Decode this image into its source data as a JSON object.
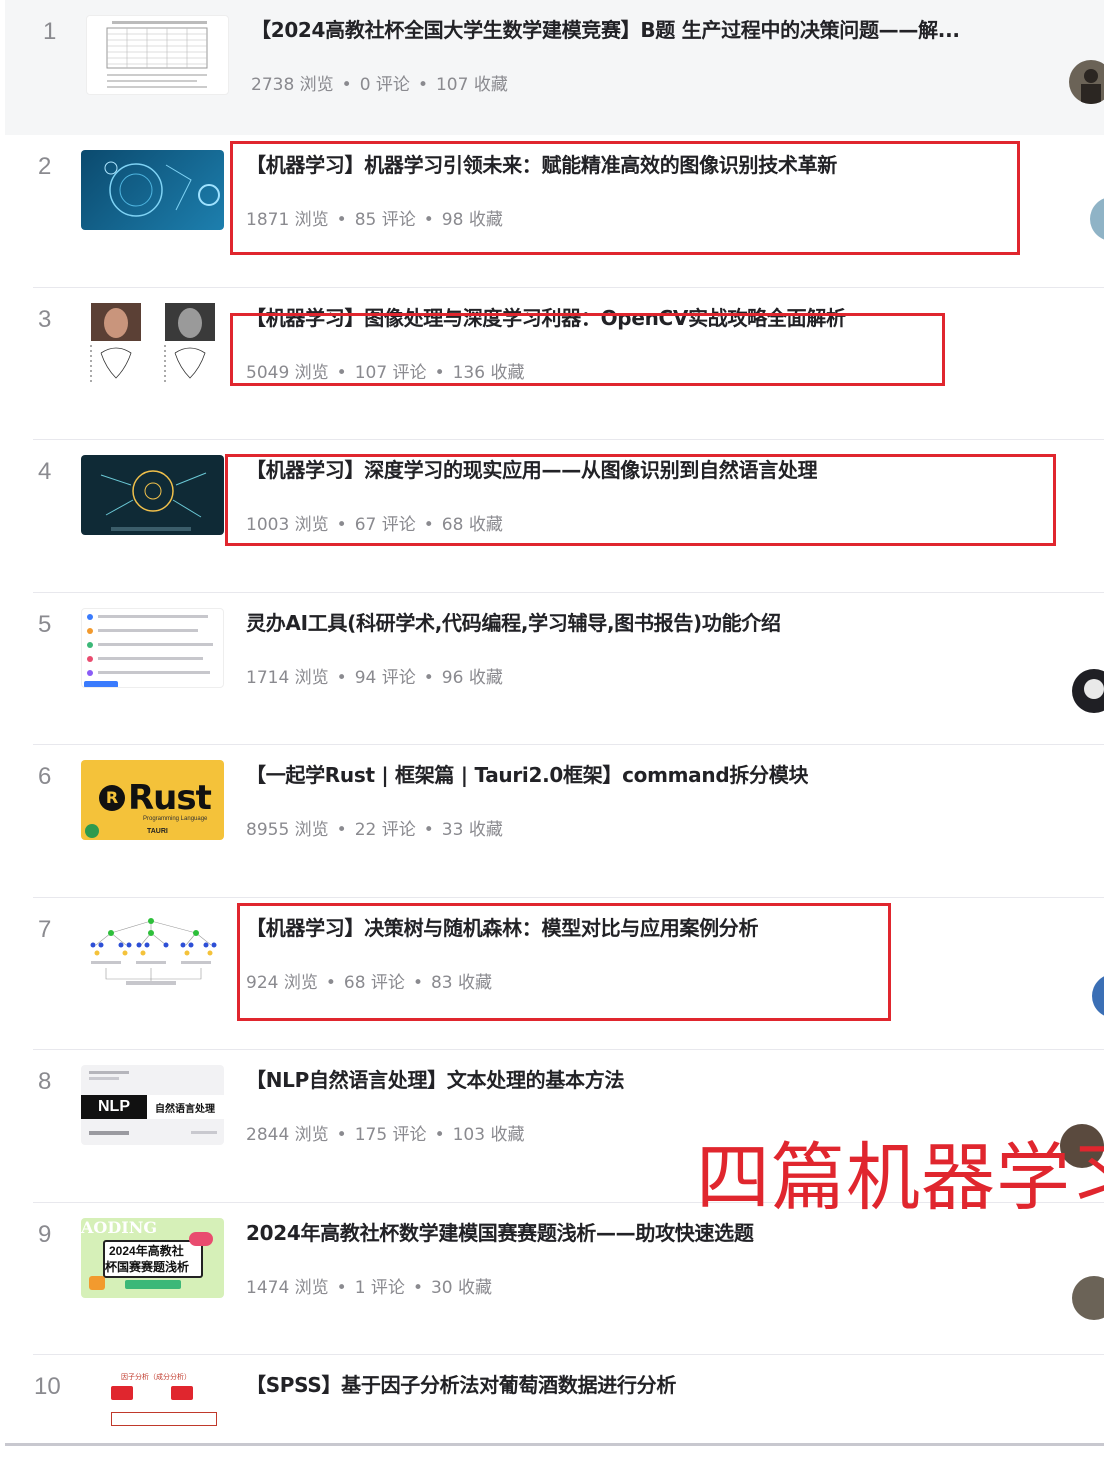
{
  "articles": [
    {
      "rank": "1",
      "title": "【2024高教社杯全国大学生数学建模竞赛】B题 生产过程中的决策问题——解...",
      "views": "2738 浏览",
      "comments": "0 评论",
      "favorites": "107 收藏"
    },
    {
      "rank": "2",
      "title": "【机器学习】机器学习引领未来：赋能精准高效的图像识别技术革新",
      "views": "1871 浏览",
      "comments": "85 评论",
      "favorites": "98 收藏"
    },
    {
      "rank": "3",
      "title": "【机器学习】图像处理与深度学习利器：OpenCV实战攻略全面解析",
      "views": "5049 浏览",
      "comments": "107 评论",
      "favorites": "136 收藏"
    },
    {
      "rank": "4",
      "title": "【机器学习】深度学习的现实应用——从图像识别到自然语言处理",
      "views": "1003 浏览",
      "comments": "67 评论",
      "favorites": "68 收藏"
    },
    {
      "rank": "5",
      "title": "灵办AI工具(科研学术,代码编程,学习辅导,图书报告)功能介绍",
      "views": "1714 浏览",
      "comments": "94 评论",
      "favorites": "96 收藏"
    },
    {
      "rank": "6",
      "title": "【一起学Rust | 框架篇 | Tauri2.0框架】command拆分模块",
      "views": "8955 浏览",
      "comments": "22 评论",
      "favorites": "33 收藏"
    },
    {
      "rank": "7",
      "title": "【机器学习】决策树与随机森林：模型对比与应用案例分析",
      "views": "924 浏览",
      "comments": "68 评论",
      "favorites": "83 收藏"
    },
    {
      "rank": "8",
      "title": "【NLP自然语言处理】文本处理的基本方法",
      "views": "2844 浏览",
      "comments": "175 评论",
      "favorites": "103 收藏"
    },
    {
      "rank": "9",
      "title": "2024年高教社杯数学建模国赛赛题浅析——助攻快速选题",
      "views": "1474 浏览",
      "comments": "1 评论",
      "favorites": "30 收藏"
    },
    {
      "rank": "10",
      "title": "【SPSS】基于因子分析法对葡萄酒数据进行分析",
      "views": "",
      "comments": "",
      "favorites": ""
    }
  ],
  "thumbs": {
    "rust_logo": "Rust",
    "rust_sub": "Programming Language",
    "tauri": "TAURI",
    "nlp_badge": "NLP",
    "nlp_label": "自然语言处理",
    "gaoding": "AODING",
    "contest_line1": "2024年高教社",
    "contest_line2": "杯国赛赛题浅析",
    "spss_header": "因子分析（成分分析）"
  },
  "annotation": "四篇机器学习",
  "colors": {
    "accent_red": "#e0262e",
    "meta_gray": "#8a8a8f",
    "title_dark": "#222226"
  }
}
